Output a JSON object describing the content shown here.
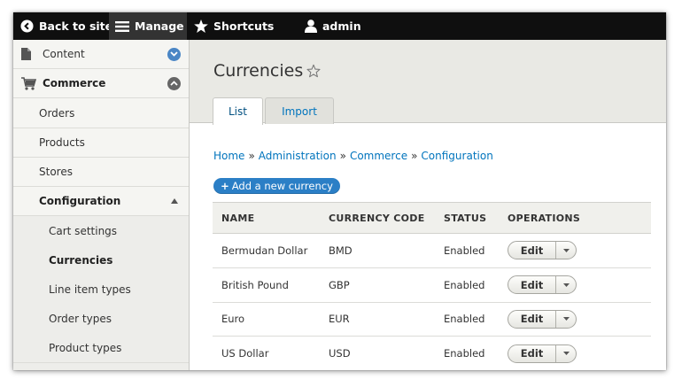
{
  "toolbar": {
    "back_label": "Back to site",
    "manage_label": "Manage",
    "shortcuts_label": "Shortcuts",
    "user_label": "admin"
  },
  "sidebar": {
    "content": {
      "label": "Content"
    },
    "commerce": {
      "label": "Commerce"
    },
    "items": [
      {
        "label": "Orders"
      },
      {
        "label": "Products"
      },
      {
        "label": "Stores"
      },
      {
        "label": "Configuration"
      }
    ],
    "config_items": [
      {
        "label": "Cart settings"
      },
      {
        "label": "Currencies"
      },
      {
        "label": "Line item types"
      },
      {
        "label": "Order types"
      },
      {
        "label": "Product types"
      }
    ]
  },
  "page": {
    "title": "Currencies",
    "tabs": [
      {
        "label": "List",
        "active": true
      },
      {
        "label": "Import",
        "active": false
      }
    ],
    "breadcrumb": [
      "Home",
      "Administration",
      "Commerce",
      "Configuration"
    ],
    "breadcrumb_separator": "»",
    "add_button": {
      "plus": "+",
      "label": "Add a new currency"
    }
  },
  "table": {
    "headers": [
      "Name",
      "Currency code",
      "Status",
      "Operations"
    ],
    "rows": [
      {
        "name": "Bermudan Dollar",
        "code": "BMD",
        "status": "Enabled",
        "operation": "Edit"
      },
      {
        "name": "British Pound",
        "code": "GBP",
        "status": "Enabled",
        "operation": "Edit"
      },
      {
        "name": "Euro",
        "code": "EUR",
        "status": "Enabled",
        "operation": "Edit"
      },
      {
        "name": "US Dollar",
        "code": "USD",
        "status": "Enabled",
        "operation": "Edit"
      }
    ]
  },
  "colors": {
    "toolbar_bg": "#0f0f0f",
    "manage_bg": "#333333",
    "link": "#0074bd",
    "primary_button": "#2b7fc6",
    "expand_circle": "#4a86c5"
  },
  "icons": {
    "back": "drupal-drop-icon",
    "manage": "hamburger-icon",
    "shortcuts": "star-icon",
    "user": "user-icon",
    "content": "file-icon",
    "commerce": "cart-icon",
    "title_star": "star-outline-icon"
  }
}
